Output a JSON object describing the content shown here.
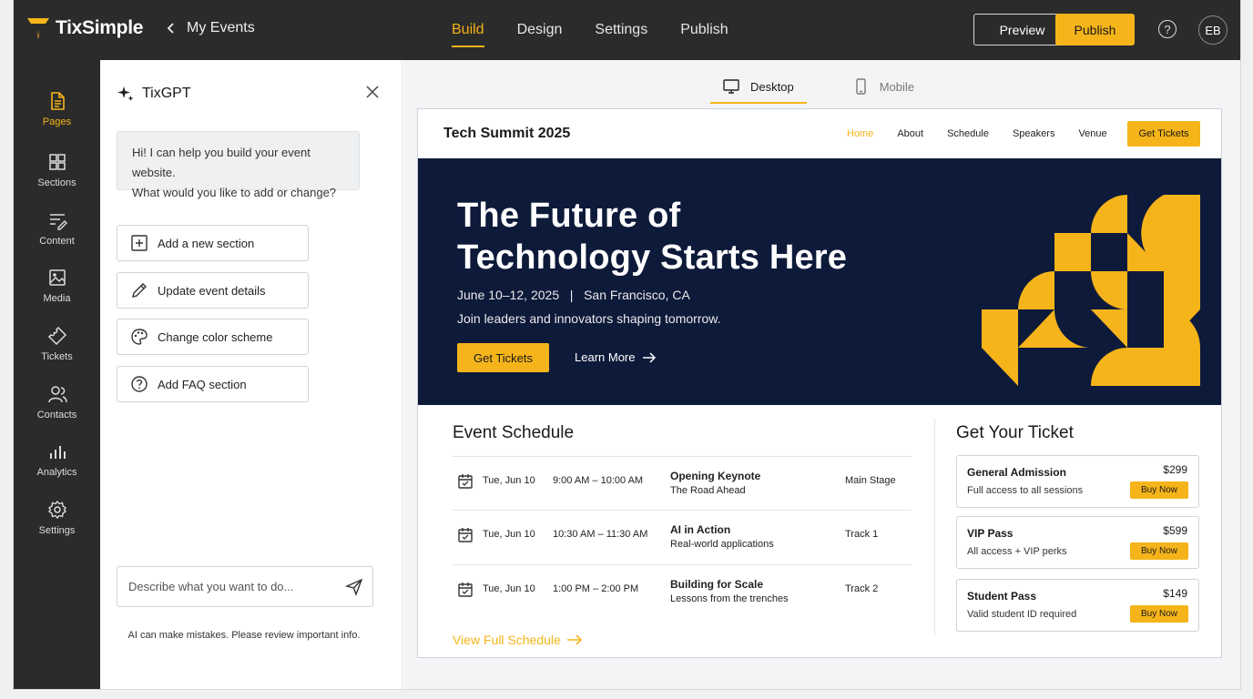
{
  "app": {
    "brand": "TixSimple",
    "back_label": "My Events",
    "tabs": [
      {
        "label": "Build",
        "active": true
      },
      {
        "label": "Design"
      },
      {
        "label": "Settings"
      },
      {
        "label": "Publish"
      }
    ],
    "preview_label": "Preview",
    "publish_label": "Publish",
    "help_glyph": "?",
    "avatar_initials": "EB",
    "accent_color": "#f5b41a",
    "dark_color": "#2b2b2b"
  },
  "rail": {
    "items": [
      {
        "label": "Pages",
        "icon": "page-icon",
        "active": true
      },
      {
        "label": "Sections",
        "icon": "grid-icon"
      },
      {
        "label": "Content",
        "icon": "edit-lines-icon"
      },
      {
        "label": "Media",
        "icon": "image-icon"
      },
      {
        "label": "Tickets",
        "icon": "ticket-icon"
      },
      {
        "label": "Contacts",
        "icon": "people-icon"
      },
      {
        "label": "Analytics",
        "icon": "bar-chart-icon"
      },
      {
        "label": "Settings",
        "icon": "gear-icon"
      }
    ]
  },
  "chat": {
    "title": "TixGPT",
    "greeting_line1": "Hi! I can help you build your event website.",
    "greeting_line2": "What would you like to add or change?",
    "actions": [
      {
        "label": "Add a new section",
        "icon": "plus-square-icon"
      },
      {
        "label": "Update event details",
        "icon": "pencil-icon"
      },
      {
        "label": "Change color scheme",
        "icon": "palette-icon"
      },
      {
        "label": "Add FAQ section",
        "icon": "question-circle-icon"
      }
    ],
    "input_placeholder": "Describe what you want to do...",
    "disclaimer": "AI can make mistakes. Please review important info."
  },
  "canvas": {
    "devices": [
      {
        "label": "Desktop",
        "active": true
      },
      {
        "label": "Mobile"
      }
    ]
  },
  "site": {
    "title": "Tech Summit 2025",
    "nav": [
      {
        "label": "Home",
        "active": true
      },
      {
        "label": "About"
      },
      {
        "label": "Schedule"
      },
      {
        "label": "Speakers"
      },
      {
        "label": "Venue"
      }
    ],
    "nav_cta": "Get Tickets",
    "hero": {
      "headline": "The Future of Technology Starts Here",
      "meta": "June 10–12, 2025   |   San Francisco, CA",
      "sub": "Join leaders and innovators shaping tomorrow.",
      "cta": "Get Tickets",
      "learn_more": "Learn More",
      "bg_color": "#0e1a3a"
    },
    "schedule": {
      "title": "Event Schedule",
      "rows": [
        {
          "date": "Tue, Jun 10",
          "time": "9:00 AM – 10:00 AM",
          "title": "Opening Keynote",
          "sub": "The Road Ahead",
          "room": "Main Stage"
        },
        {
          "date": "Tue, Jun 10",
          "time": "10:30 AM – 11:30 AM",
          "title": "AI in Action",
          "sub": "Real-world applications",
          "room": "Track 1"
        },
        {
          "date": "Tue, Jun 10",
          "time": "1:00 PM – 2:00 PM",
          "title": "Building for Scale",
          "sub": "Lessons from the trenches",
          "room": "Track 2"
        }
      ],
      "view_full": "View Full Schedule"
    },
    "tickets": {
      "title": "Get Your Ticket",
      "items": [
        {
          "name": "General Admission",
          "desc": "Full access to all sessions",
          "price": "$299",
          "cta": "Buy Now"
        },
        {
          "name": "VIP Pass",
          "desc": "All access + VIP perks",
          "price": "$599",
          "cta": "Buy Now"
        },
        {
          "name": "Student Pass",
          "desc": "Valid student ID required",
          "price": "$149",
          "cta": "Buy Now"
        }
      ]
    }
  }
}
